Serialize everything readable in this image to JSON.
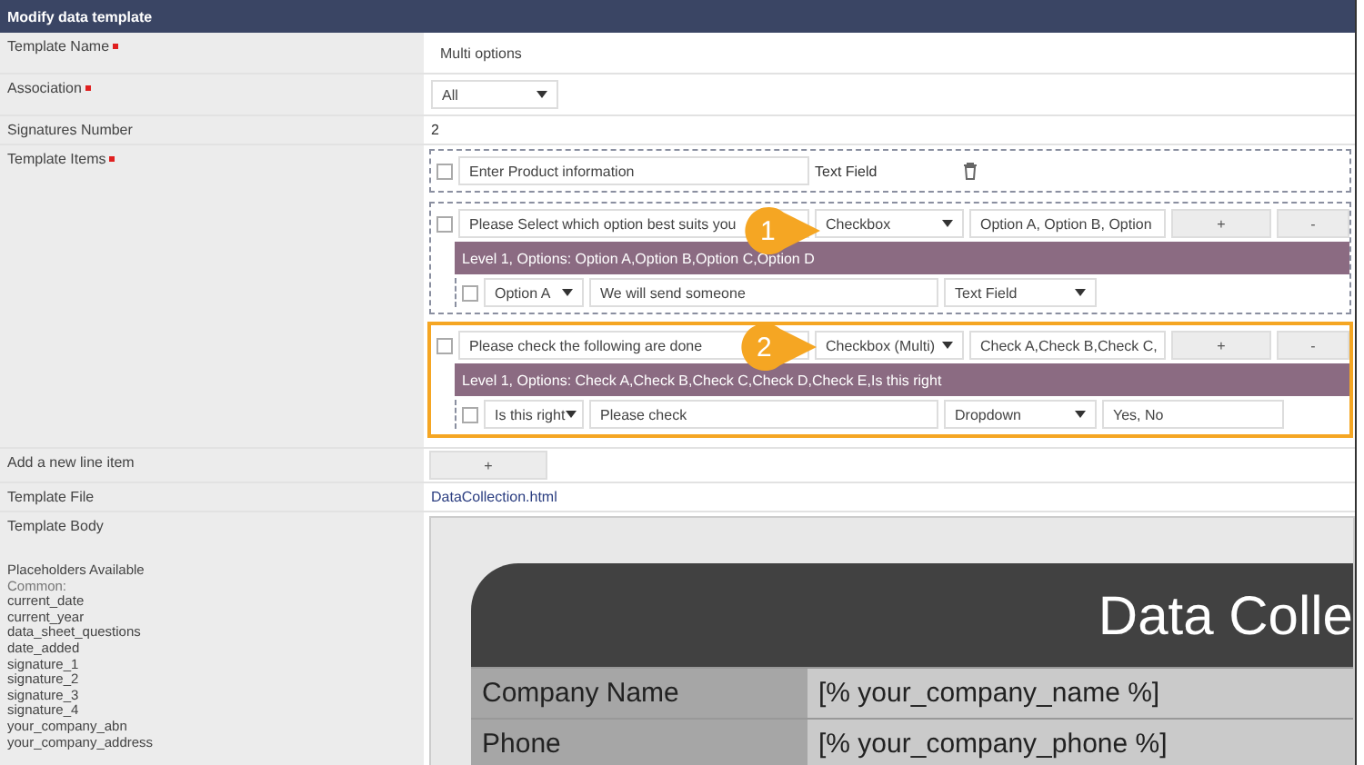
{
  "panel": {
    "title": "Modify data template"
  },
  "template_name": {
    "label": "Template Name",
    "required": true,
    "value": "Multi options"
  },
  "association": {
    "label": "Association",
    "required": true,
    "value": "All"
  },
  "signatures": {
    "label": "Signatures Number",
    "value": "2"
  },
  "template_items": {
    "label": "Template Items",
    "required": true,
    "items": [
      {
        "kind": "text",
        "checked": false,
        "question": "Enter Product information",
        "type": "Text Field",
        "highlighted": false
      },
      {
        "kind": "choice",
        "checked": false,
        "question": "Please Select which option best suits you",
        "type": "Checkbox",
        "options": "Option A, Option B, Option",
        "add": "+",
        "remove": "-",
        "level_title": "Level 1, Options: Option A,Option B,Option C,Option D",
        "callout": "1",
        "highlighted": false,
        "children": [
          {
            "checked": false,
            "option": "Option A",
            "text": "We will send someone",
            "type": "Text Field"
          }
        ]
      },
      {
        "kind": "choice",
        "checked": false,
        "question": "Please check the following are done",
        "type": "Checkbox (Multi)",
        "options": "Check A,Check B,Check C,",
        "add": "+",
        "remove": "-",
        "level_title": "Level 1, Options: Check A,Check B,Check C,Check D,Check E,Is this right",
        "callout": "2",
        "highlighted": true,
        "children": [
          {
            "checked": false,
            "option": "Is this right",
            "text": "Please check",
            "type": "Dropdown",
            "values": "Yes, No"
          }
        ]
      }
    ]
  },
  "add_line": {
    "label": "Add a new line item",
    "button": "+"
  },
  "template_file": {
    "label": "Template File",
    "value": "DataCollection.html"
  },
  "template_body": {
    "label": "Template Body",
    "placeholders_title": "Placeholders Available",
    "group": "Common:",
    "placeholders": [
      "current_date",
      "current_year",
      "data_sheet_questions",
      "date_added",
      "signature_1",
      "signature_2",
      "signature_3",
      "signature_4",
      "your_company_abn",
      "your_company_address"
    ],
    "preview": {
      "title": "Data Colle",
      "rows": [
        {
          "label": "Company Name",
          "value": "[% your_company_name %]"
        },
        {
          "label": "Phone",
          "value": "[% your_company_phone %]"
        }
      ]
    }
  }
}
